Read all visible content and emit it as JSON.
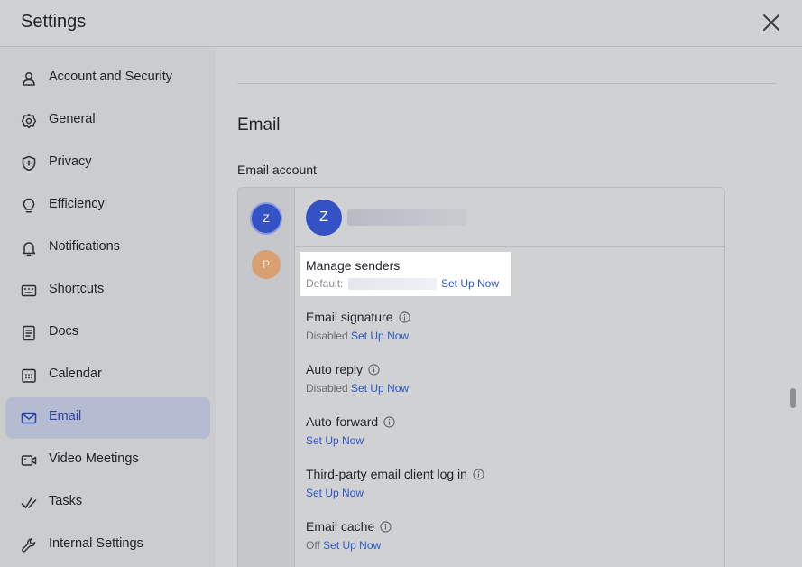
{
  "header": {
    "title": "Settings"
  },
  "sidebar": {
    "items": [
      {
        "label": "Account and Security"
      },
      {
        "label": "General"
      },
      {
        "label": "Privacy"
      },
      {
        "label": "Efficiency"
      },
      {
        "label": "Notifications"
      },
      {
        "label": "Shortcuts"
      },
      {
        "label": "Docs"
      },
      {
        "label": "Calendar"
      },
      {
        "label": "Email",
        "active": true
      },
      {
        "label": "Video Meetings"
      },
      {
        "label": "Tasks"
      },
      {
        "label": "Internal Settings"
      }
    ]
  },
  "main": {
    "section_title": "Email",
    "email_account_label": "Email account",
    "accounts": [
      {
        "initial": "Z",
        "color": "#3552c4"
      },
      {
        "initial": "P",
        "color": "#d8a070"
      }
    ],
    "selected_account": {
      "initial": "Z"
    },
    "settings": {
      "manage_senders": {
        "title": "Manage senders",
        "desc": "Default:",
        "link": "Set Up Now"
      },
      "email_signature": {
        "title": "Email signature",
        "status": "Disabled",
        "link": "Set Up Now"
      },
      "auto_reply": {
        "title": "Auto reply",
        "status": "Disabled",
        "link": "Set Up Now"
      },
      "auto_forward": {
        "title": "Auto-forward",
        "link": "Set Up Now"
      },
      "third_party": {
        "title": "Third-party email client log in",
        "link": "Set Up Now"
      },
      "email_cache": {
        "title": "Email cache",
        "status": "Off",
        "link": "Set Up Now"
      }
    }
  },
  "colors": {
    "accent": "#2e57c8",
    "active_bg": "#b5bbd0"
  }
}
